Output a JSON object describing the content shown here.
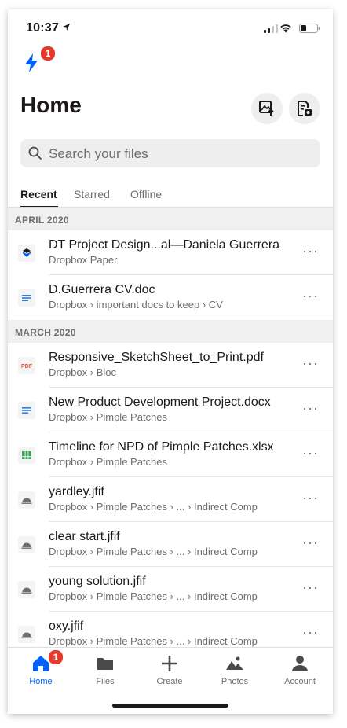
{
  "status": {
    "time": "10:37"
  },
  "app": {
    "notification_count": "1"
  },
  "header": {
    "title": "Home"
  },
  "search": {
    "placeholder": "Search your files"
  },
  "tabs": [
    {
      "label": "Recent"
    },
    {
      "label": "Starred"
    },
    {
      "label": "Offline"
    }
  ],
  "sections": [
    {
      "label": "APRIL 2020",
      "files": [
        {
          "name": "DT Project Design...al—Daniela Guerrera",
          "path": "Dropbox Paper",
          "icon": "paper-icon"
        },
        {
          "name": "D.Guerrera CV.doc",
          "path": "Dropbox › important docs to keep › CV",
          "icon": "document-icon"
        }
      ]
    },
    {
      "label": "MARCH 2020",
      "files": [
        {
          "name": "Responsive_SketchSheet_to_Print.pdf",
          "path": "Dropbox › Bloc",
          "icon": "pdf-icon"
        },
        {
          "name": "New Product Development Project.docx",
          "path": "Dropbox › Pimple Patches",
          "icon": "document-icon"
        },
        {
          "name": "Timeline for NPD of Pimple Patches.xlsx",
          "path": "Dropbox › Pimple Patches",
          "icon": "spreadsheet-icon"
        },
        {
          "name": "yardley.jfif",
          "path": "Dropbox › Pimple Patches › ... › Indirect Comp",
          "icon": "image-icon"
        },
        {
          "name": "clear start.jfif",
          "path": "Dropbox › Pimple Patches › ... › Indirect Comp",
          "icon": "image-icon"
        },
        {
          "name": "young solution.jfif",
          "path": "Dropbox › Pimple Patches › ... › Indirect Comp",
          "icon": "image-icon"
        },
        {
          "name": "oxy.jfif",
          "path": "Dropbox › Pimple Patches › ... › Indirect Comp",
          "icon": "image-icon"
        }
      ]
    }
  ],
  "more_label": "···",
  "pdf_glyph": "PDF",
  "tabbar": [
    {
      "label": "Home",
      "icon": "home-icon",
      "badge": "1"
    },
    {
      "label": "Files",
      "icon": "folder-icon"
    },
    {
      "label": "Create",
      "icon": "plus-icon"
    },
    {
      "label": "Photos",
      "icon": "photos-icon"
    },
    {
      "label": "Account",
      "icon": "person-icon"
    }
  ],
  "colors": {
    "accent": "#0061fe",
    "badge": "#e53a2d",
    "text": "#1e1919",
    "secondary": "#6e6e6e"
  }
}
